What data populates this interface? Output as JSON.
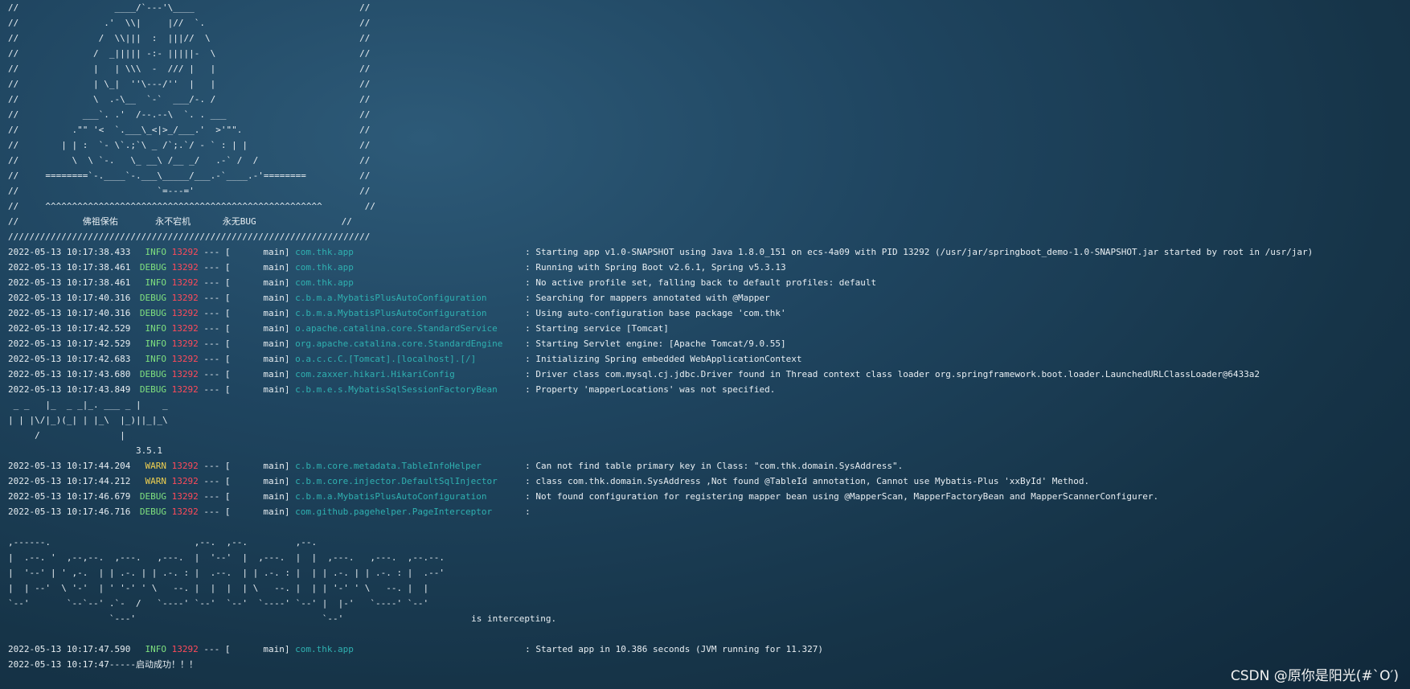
{
  "banner_lines": [
    "//                  ____/`---'\\____                               //",
    "//                .'  \\\\|     |//  `.                             //",
    "//               /  \\\\|||  :  |||//  \\                            //",
    "//              /  _||||| -:- |||||-  \\                           //",
    "//              |   | \\\\\\  -  /// |   |                           //",
    "//              | \\_|  ''\\---/''  |   |                           //",
    "//              \\  .-\\__  `-`  ___/-. /                           //",
    "//            ___`. .'  /--.--\\  `. . ___                         //",
    "//          .\"\" '<  `.___\\_<|>_/___.'  >'\"\".                      //",
    "//        | | :  `- \\`.;`\\ _ /`;.`/ - ` : | |                     //",
    "//          \\  \\ `-.   \\_ __\\ /__ _/   .-` /  /                   //",
    "//     ========`-.____`-.___\\_____/___.-`____.-'========          //",
    "//                          `=---='                               //",
    "//     ^^^^^^^^^^^^^^^^^^^^^^^^^^^^^^^^^^^^^^^^^^^^^^^^^^^^        //",
    "//            佛祖保佑       永不宕机      永无BUG                //",
    "////////////////////////////////////////////////////////////////////"
  ],
  "log1": [
    {
      "ts": "2022-05-13 10:17:38.433",
      "level": "INFO",
      "pid": "13292",
      "sep": "--- [",
      "thread": "main]",
      "logger": "com.thk.app",
      "msg": ": Starting app v1.0-SNAPSHOT using Java 1.8.0_151 on ecs-4a09 with PID 13292 (/usr/jar/springboot_demo-1.0-SNAPSHOT.jar started by root in /usr/jar)"
    },
    {
      "ts": "2022-05-13 10:17:38.461",
      "level": "DEBUG",
      "pid": "13292",
      "sep": "--- [",
      "thread": "main]",
      "logger": "com.thk.app",
      "msg": ": Running with Spring Boot v2.6.1, Spring v5.3.13"
    },
    {
      "ts": "2022-05-13 10:17:38.461",
      "level": "INFO",
      "pid": "13292",
      "sep": "--- [",
      "thread": "main]",
      "logger": "com.thk.app",
      "msg": ": No active profile set, falling back to default profiles: default"
    },
    {
      "ts": "2022-05-13 10:17:40.316",
      "level": "DEBUG",
      "pid": "13292",
      "sep": "--- [",
      "thread": "main]",
      "logger": "c.b.m.a.MybatisPlusAutoConfiguration",
      "msg": ": Searching for mappers annotated with @Mapper"
    },
    {
      "ts": "2022-05-13 10:17:40.316",
      "level": "DEBUG",
      "pid": "13292",
      "sep": "--- [",
      "thread": "main]",
      "logger": "c.b.m.a.MybatisPlusAutoConfiguration",
      "msg": ": Using auto-configuration base package 'com.thk'"
    },
    {
      "ts": "2022-05-13 10:17:42.529",
      "level": "INFO",
      "pid": "13292",
      "sep": "--- [",
      "thread": "main]",
      "logger": "o.apache.catalina.core.StandardService",
      "msg": ": Starting service [Tomcat]"
    },
    {
      "ts": "2022-05-13 10:17:42.529",
      "level": "INFO",
      "pid": "13292",
      "sep": "--- [",
      "thread": "main]",
      "logger": "org.apache.catalina.core.StandardEngine",
      "msg": ": Starting Servlet engine: [Apache Tomcat/9.0.55]"
    },
    {
      "ts": "2022-05-13 10:17:42.683",
      "level": "INFO",
      "pid": "13292",
      "sep": "--- [",
      "thread": "main]",
      "logger": "o.a.c.c.C.[Tomcat].[localhost].[/]",
      "msg": ": Initializing Spring embedded WebApplicationContext"
    },
    {
      "ts": "2022-05-13 10:17:43.680",
      "level": "DEBUG",
      "pid": "13292",
      "sep": "--- [",
      "thread": "main]",
      "logger": "com.zaxxer.hikari.HikariConfig",
      "msg": ": Driver class com.mysql.cj.jdbc.Driver found in Thread context class loader org.springframework.boot.loader.LaunchedURLClassLoader@6433a2"
    },
    {
      "ts": "2022-05-13 10:17:43.849",
      "level": "DEBUG",
      "pid": "13292",
      "sep": "--- [",
      "thread": "main]",
      "logger": "c.b.m.e.s.MybatisSqlSessionFactoryBean",
      "msg": ": Property 'mapperLocations' was not specified."
    }
  ],
  "mp_banner": [
    " _ _   |_  _ _|_. ___ _ |    _",
    "| | |\\/|_)(_| | |_\\  |_)||_|_\\",
    "     /               |",
    "                        3.5.1"
  ],
  "log2": [
    {
      "ts": "2022-05-13 10:17:44.204",
      "level": "WARN",
      "pid": "13292",
      "sep": "--- [",
      "thread": "main]",
      "logger": "c.b.m.core.metadata.TableInfoHelper",
      "msg": ": Can not find table primary key in Class: \"com.thk.domain.SysAddress\"."
    },
    {
      "ts": "2022-05-13 10:17:44.212",
      "level": "WARN",
      "pid": "13292",
      "sep": "--- [",
      "thread": "main]",
      "logger": "c.b.m.core.injector.DefaultSqlInjector",
      "msg": ": class com.thk.domain.SysAddress ,Not found @TableId annotation, Cannot use Mybatis-Plus 'xxById' Method."
    },
    {
      "ts": "2022-05-13 10:17:46.679",
      "level": "DEBUG",
      "pid": "13292",
      "sep": "--- [",
      "thread": "main]",
      "logger": "c.b.m.a.MybatisPlusAutoConfiguration",
      "msg": ": Not found configuration for registering mapper bean using @MapperScan, MapperFactoryBean and MapperScannerConfigurer."
    },
    {
      "ts": "2022-05-13 10:17:46.716",
      "level": "DEBUG",
      "pid": "13292",
      "sep": "--- [",
      "thread": "main]",
      "logger": "com.github.pagehelper.PageInterceptor",
      "msg": ":"
    }
  ],
  "ph_banner": [
    "",
    ",------.                           ,--.  ,--.         ,--.",
    "|  .--. '  ,--,--.  ,---.   ,---.  |  '--'  |  ,---.  |  |  ,---.   ,---.  ,--.--.",
    "|  '--' | ' ,-.  | | .-. | | .-. : |  .--.  | | .-. : |  | | .-. | | .-. : |  .--'",
    "|  | --'  \\ '-'  | ' '-' ' \\   --. |  |  |  | \\   --. |  | | '-' ' \\   --. |  |",
    "`--'       `--`--' .`-  /   `----' `--'  `--'  `----' `--' |  |-'   `----' `--'",
    "                   `---'                                   `--'                        is intercepting.",
    ""
  ],
  "log3": [
    {
      "ts": "2022-05-13 10:17:47.590",
      "level": "INFO",
      "pid": "13292",
      "sep": "--- [",
      "thread": "main]",
      "logger": "com.thk.app",
      "msg": ": Started app in 10.386 seconds (JVM running for 11.327)"
    }
  ],
  "final_line": "2022-05-13 10:17:47-----启动成功！！！",
  "watermark": "CSDN @原你是阳光(#`O′)",
  "colors": {
    "info": "#7fe07f",
    "warn": "#f0d050",
    "pid": "#ff4a5a",
    "logger": "#2fb0b0",
    "text": "#e8eef2"
  }
}
